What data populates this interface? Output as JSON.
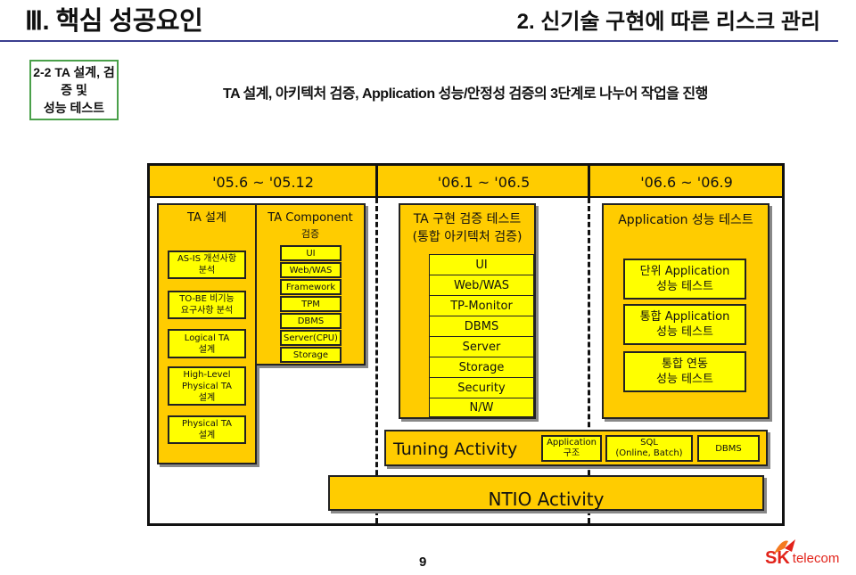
{
  "header": {
    "section_title": "Ⅲ. 핵심 성공요인",
    "subsection_title": "2. 신기술 구현에 따른 리스크 관리"
  },
  "subsection": {
    "label_line1": "2-2 TA 설계, 검증 및",
    "label_line2": "성능 테스트",
    "description": "TA 설계, 아키텍처 검증, Application 성능/안정성 검증의 3단계로  나누어 작업을 진행"
  },
  "periods": [
    "'05.6 ~ '05.12",
    "'06.1 ~ '06.5",
    "'06.6 ~ '06.9"
  ],
  "phase1": {
    "ta_design": {
      "title": "TA 설계",
      "items": [
        {
          "line1": "AS-IS 개선사항",
          "line2": "분석"
        },
        {
          "line1": "TO-BE 비기능",
          "line2": "요구사항 분석"
        },
        {
          "line1": "Logical TA",
          "line2": "설계"
        },
        {
          "line1": "High-Level",
          "line2": "Physical TA",
          "line3": "설계"
        },
        {
          "line1": "Physical TA",
          "line2": "설계"
        }
      ]
    },
    "component": {
      "title_line1": "TA Component",
      "title_line2": "검증",
      "items": [
        "UI",
        "Web/WAS",
        "Framework",
        "TPM",
        "DBMS",
        "Server(CPU)",
        "Storage"
      ]
    }
  },
  "phase2": {
    "title_line1": "TA 구현 검증 테스트",
    "title_line2": "(통합 아키텍처 검증)",
    "items": [
      "UI",
      "Web/WAS",
      "TP-Monitor",
      "DBMS",
      "Server",
      "Storage",
      "Security",
      "N/W"
    ]
  },
  "phase3": {
    "title": "Application 성능 테스트",
    "items": [
      {
        "line1": "단위 Application",
        "line2": "성능 테스트"
      },
      {
        "line1": "통합 Application",
        "line2": "성능 테스트"
      },
      {
        "line1": "통합 연동",
        "line2": "성능 테스트"
      }
    ]
  },
  "tuning": {
    "label": "Tuning Activity",
    "items": [
      {
        "line1": "Application",
        "line2": "구조"
      },
      {
        "line1": "SQL",
        "line2": "(Online, Batch)"
      },
      {
        "line1": "DBMS",
        "line2": ""
      }
    ]
  },
  "ntio": {
    "label": "NTIO Activity"
  },
  "footer": {
    "page_number": "9",
    "logo_sk": "SK",
    "logo_telecom": "telecom"
  },
  "colors": {
    "phase_fill": "#ffcc00",
    "item_fill": "#ffff00",
    "rule": "#3b3f8f",
    "sub_border": "#4aa04a",
    "logo_red": "#e2231a",
    "logo_orange": "#f47a20"
  }
}
